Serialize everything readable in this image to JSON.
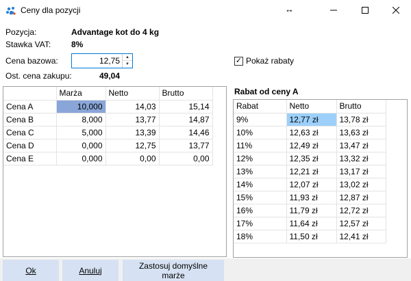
{
  "window": {
    "title": "Ceny dla pozycji"
  },
  "info": {
    "position_label": "Pozycja:",
    "position_value": "Advantage kot do 4 kg",
    "vat_label": "Stawka VAT:",
    "vat_value": "8%",
    "base_price_label": "Cena bazowa:",
    "base_price_value": "12,75",
    "last_purchase_label": "Ost. cena zakupu:",
    "last_purchase_value": "49,04"
  },
  "show_discounts": {
    "label": "Pokaż rabaty",
    "checked": true
  },
  "prices_table": {
    "columns": [
      "",
      "Marża",
      "Netto",
      "Brutto"
    ],
    "rows": [
      {
        "name": "Cena A",
        "margin": "10,000",
        "net": "14,03",
        "gross": "15,14"
      },
      {
        "name": "Cena B",
        "margin": "8,000",
        "net": "13,77",
        "gross": "14,87"
      },
      {
        "name": "Cena C",
        "margin": "5,000",
        "net": "13,39",
        "gross": "14,46"
      },
      {
        "name": "Cena D",
        "margin": "0,000",
        "net": "12,75",
        "gross": "13,77"
      },
      {
        "name": "Cena E",
        "margin": "0,000",
        "net": "0,00",
        "gross": "0,00"
      }
    ]
  },
  "discount_table": {
    "title": "Rabat od ceny A",
    "columns": [
      "Rabat",
      "Netto",
      "Brutto"
    ],
    "rows": [
      {
        "rate": "9%",
        "net": "12,77 zł",
        "gross": "13,78 zł"
      },
      {
        "rate": "10%",
        "net": "12,63 zł",
        "gross": "13,63 zł"
      },
      {
        "rate": "11%",
        "net": "12,49 zł",
        "gross": "13,47 zł"
      },
      {
        "rate": "12%",
        "net": "12,35 zł",
        "gross": "13,32 zł"
      },
      {
        "rate": "13%",
        "net": "12,21 zł",
        "gross": "13,17 zł"
      },
      {
        "rate": "14%",
        "net": "12,07 zł",
        "gross": "13,02 zł"
      },
      {
        "rate": "15%",
        "net": "11,93 zł",
        "gross": "12,87 zł"
      },
      {
        "rate": "16%",
        "net": "11,79 zł",
        "gross": "12,72 zł"
      },
      {
        "rate": "17%",
        "net": "11,64 zł",
        "gross": "12,57 zł"
      },
      {
        "rate": "18%",
        "net": "11,50 zł",
        "gross": "12,41 zł"
      }
    ]
  },
  "buttons": {
    "ok": "Ok",
    "cancel": "Anuluj",
    "apply_defaults": "Zastosuj domyślne marże"
  },
  "colors": {
    "selected_cell": "#8aa6d8",
    "selected_discount_cell": "#9cd0fb",
    "button_bg": "#d6e2f3",
    "input_border": "#0078d7"
  }
}
